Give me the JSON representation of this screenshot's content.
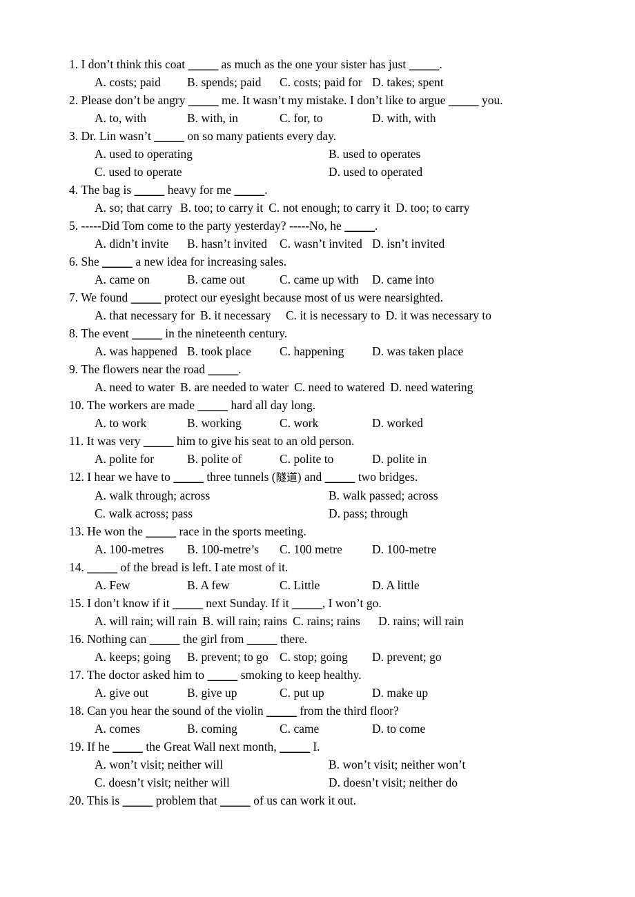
{
  "document": {
    "type": "english-grammar-multiple-choice-worksheet",
    "blank_marker": "_____",
    "questions": [
      {
        "number": "1.",
        "stem_parts": [
          "1. I don’t think this coat ",
          "BLANK",
          " as much as the one your sister has just ",
          "BLANK",
          "."
        ],
        "layout": "layout-4",
        "option_rows": [
          [
            "A. costs; paid",
            "B. spends; paid",
            "C. costs; paid for",
            "D. takes; spent"
          ]
        ]
      },
      {
        "number": "2.",
        "stem_parts": [
          "2. Please don’t be angry ",
          "BLANK",
          " me. It wasn’t my mistake. I don’t like to argue ",
          "BLANK",
          " you."
        ],
        "layout": "layout-4",
        "option_rows": [
          [
            "A. to, with",
            "B. with, in",
            "C. for, to",
            "D. with, with"
          ]
        ]
      },
      {
        "number": "3.",
        "stem_parts": [
          "3. Dr. Lin wasn’t ",
          "BLANK",
          " on so many patients every day."
        ],
        "layout": "layout-2",
        "option_rows": [
          [
            "A. used to operating",
            "B. used to operates"
          ],
          [
            "C. used to operate",
            "D. used to operated"
          ]
        ]
      },
      {
        "number": "4.",
        "stem_parts": [
          "4. The bag is ",
          "BLANK",
          " heavy for me ",
          "BLANK",
          "."
        ],
        "layout": "layout-4w",
        "option_rows": [
          [
            "A. so; that carry",
            "B. too; to carry it",
            "C. not enough; to carry it",
            "D. too; to carry"
          ]
        ]
      },
      {
        "number": "5.",
        "stem_parts": [
          "5. -----Did Tom come to the party yesterday? -----No, he ",
          "BLANK",
          "."
        ],
        "layout": "layout-4",
        "option_rows": [
          [
            "A. didn’t invite",
            "B. hasn’t invited",
            "C. wasn’t invited",
            "D. isn’t invited"
          ]
        ]
      },
      {
        "number": "6.",
        "stem_parts": [
          "6. She ",
          "BLANK",
          " a new idea for increasing sales."
        ],
        "layout": "layout-4",
        "option_rows": [
          [
            "A. came on",
            "B. came out",
            "C. came up with",
            "D. came into"
          ]
        ]
      },
      {
        "number": "7.",
        "stem_parts": [
          "7. We found ",
          "BLANK",
          " protect our eyesight because most of us were nearsighted."
        ],
        "layout": "layout-4w",
        "option_rows": [
          [
            "A. that necessary for",
            "B. it necessary",
            "C. it is necessary to",
            "D. it was necessary to"
          ]
        ]
      },
      {
        "number": "8.",
        "stem_parts": [
          "8. The event ",
          "BLANK",
          " in the nineteenth century."
        ],
        "layout": "layout-4",
        "option_rows": [
          [
            "A. was happened",
            "B. took place",
            "C. happening",
            "D. was taken place"
          ]
        ]
      },
      {
        "number": "9.",
        "stem_parts": [
          "9. The flowers near the road ",
          "BLANK",
          "."
        ],
        "layout": "layout-4w",
        "option_rows": [
          [
            "A. need to water",
            "B. are needed to water",
            "C. need to watered",
            "D. need watering"
          ]
        ]
      },
      {
        "number": "10.",
        "stem_parts": [
          "10. The workers are made ",
          "BLANK",
          " hard all day long."
        ],
        "layout": "layout-4",
        "option_rows": [
          [
            "A. to work",
            "B. working",
            "C. work",
            "D. worked"
          ]
        ]
      },
      {
        "number": "11.",
        "stem_parts": [
          "11. It was very ",
          "BLANK",
          " him to give his seat to an old person."
        ],
        "layout": "layout-4",
        "option_rows": [
          [
            "A. polite for",
            "B. polite of",
            "C. polite to",
            "D. polite in"
          ]
        ]
      },
      {
        "number": "12.",
        "stem_parts": [
          "12. I hear we have to ",
          "BLANK",
          " three tunnels (",
          "CJK:隧道",
          ") and ",
          "BLANK",
          " two bridges."
        ],
        "layout": "layout-2",
        "option_rows": [
          [
            "A. walk through; across",
            "B. walk passed; across"
          ],
          [
            "C. walk across; pass",
            "D. pass; through"
          ]
        ]
      },
      {
        "number": "13.",
        "stem_parts": [
          "13. He won the ",
          "BLANK",
          " race in the sports meeting."
        ],
        "layout": "layout-4",
        "option_rows": [
          [
            "A. 100-metres",
            "B. 100-metre’s",
            "C. 100 metre",
            "D. 100-metre"
          ]
        ]
      },
      {
        "number": "14.",
        "stem_parts": [
          "14. ",
          "BLANK",
          " of the bread is left. I ate most of it."
        ],
        "layout": "layout-4",
        "option_rows": [
          [
            "A. Few",
            "B. A few",
            "C. Little",
            "D. A little"
          ]
        ]
      },
      {
        "number": "15.",
        "stem_parts": [
          "15. I don’t know if it ",
          "BLANK",
          " next Sunday. If it ",
          "BLANK",
          ", I won’t go."
        ],
        "layout": "layout-4w",
        "option_rows": [
          [
            "A. will rain; will rain",
            "B. will rain; rains",
            "C. rains; rains",
            "D. rains; will rain"
          ]
        ]
      },
      {
        "number": "16.",
        "stem_parts": [
          "16. Nothing can ",
          "BLANK",
          " the girl from ",
          "BLANK",
          " there."
        ],
        "layout": "layout-4",
        "option_rows": [
          [
            "A. keeps; going",
            "B. prevent; to go",
            "C. stop; going",
            "D. prevent; go"
          ]
        ]
      },
      {
        "number": "17.",
        "stem_parts": [
          "17. The doctor asked him to ",
          "BLANK",
          " smoking to keep healthy."
        ],
        "layout": "layout-4",
        "option_rows": [
          [
            "A. give out",
            "B. give up",
            "C. put up",
            "D. make up"
          ]
        ]
      },
      {
        "number": "18.",
        "stem_parts": [
          "18. Can you hear the sound of the violin ",
          "BLANK",
          " from the third floor?"
        ],
        "layout": "layout-4",
        "option_rows": [
          [
            "A. comes",
            "B. coming",
            "C. came",
            "D. to come"
          ]
        ]
      },
      {
        "number": "19.",
        "stem_parts": [
          "19. If he ",
          "BLANK",
          " the Great Wall next month, ",
          "BLANK",
          " I."
        ],
        "layout": "layout-2",
        "option_rows": [
          [
            "A. won’t visit; neither will",
            "B. won’t visit; neither won’t"
          ],
          [
            "C. doesn’t visit; neither will",
            "D. doesn’t visit; neither do"
          ]
        ]
      },
      {
        "number": "20.",
        "stem_parts": [
          "20. This is ",
          "BLANK",
          " problem that ",
          "BLANK",
          " of us can work it out."
        ],
        "layout": "layout-4",
        "option_rows": []
      }
    ]
  }
}
